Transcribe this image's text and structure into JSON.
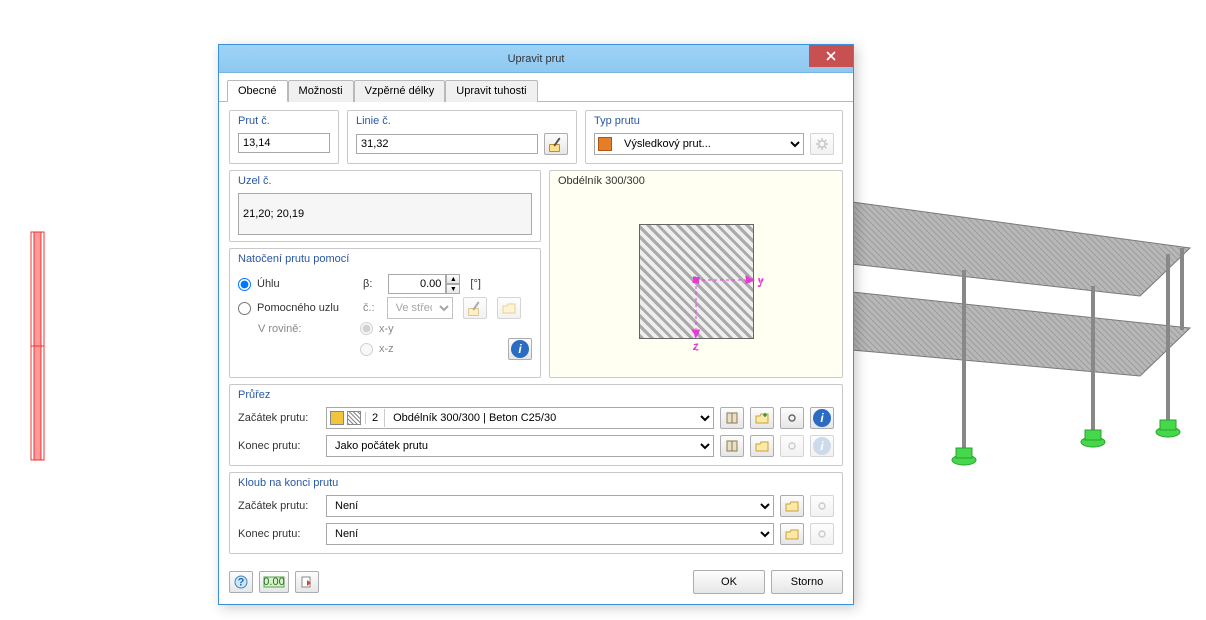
{
  "dialog": {
    "title": "Upravit prut",
    "tabs": [
      "Obecné",
      "Možnosti",
      "Vzpěrné délky",
      "Upravit tuhosti"
    ],
    "prut_c": {
      "label": "Prut č.",
      "value": "13,14"
    },
    "linie_c": {
      "label": "Linie č.",
      "value": "31,32"
    },
    "typ_prutu": {
      "label": "Typ prutu",
      "value": "Výsledkový prut..."
    },
    "uzel_c": {
      "label": "Uzel č.",
      "value": "21,20; 20,19"
    },
    "preview_label": "Obdélník 300/300",
    "rotation": {
      "label": "Natočení prutu pomocí",
      "opt_angle": "Úhlu",
      "beta": "β:",
      "beta_val": "0.00",
      "unit": "[°]",
      "opt_node": "Pomocného uzlu",
      "node_lbl": "č.:",
      "node_sel": "Ve střed…",
      "plane_lbl": "V rovině:",
      "plane_xy": "x-y",
      "plane_xz": "x-z"
    },
    "prurez": {
      "label": "Průřez",
      "start_lbl": "Začátek prutu:",
      "start_num": "2",
      "start_val": "Obdélník 300/300 | Beton C25/30",
      "end_lbl": "Konec prutu:",
      "end_val": "Jako počátek prutu"
    },
    "kloub": {
      "label": "Kloub na konci prutu",
      "start_lbl": "Začátek prutu:",
      "start_val": "Není",
      "end_lbl": "Konec prutu:",
      "end_val": "Není"
    },
    "ok": "OK",
    "cancel": "Storno"
  },
  "axes": {
    "y": "y",
    "z": "z"
  }
}
